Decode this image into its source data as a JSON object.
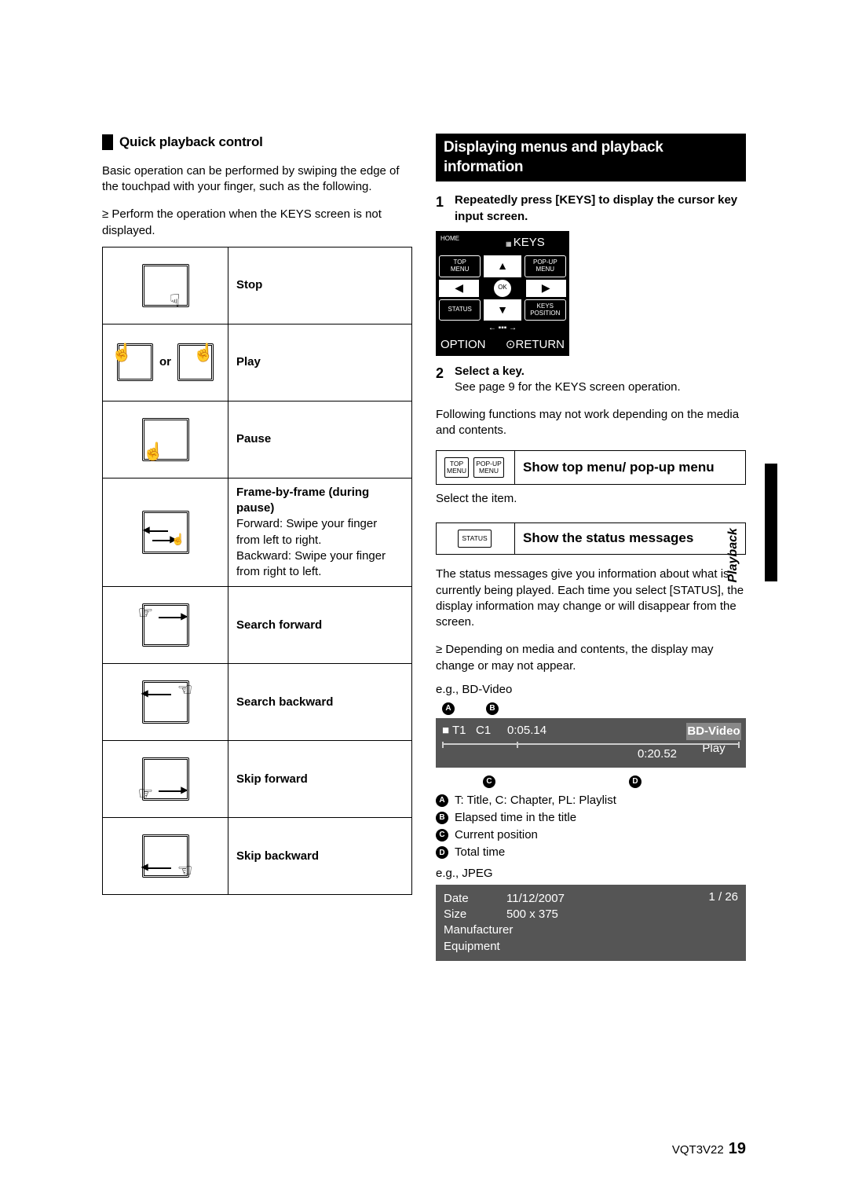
{
  "left": {
    "heading": "Quick playback control",
    "intro": "Basic operation can be performed by swiping the edge of the touchpad with your finger, such as the following.",
    "bullet": "Perform the operation when the KEYS screen is not displayed.",
    "or_label": "or",
    "gestures": [
      {
        "label": "Stop"
      },
      {
        "label": "Play"
      },
      {
        "label": "Pause"
      },
      {
        "bold": "Frame-by-frame (during pause)",
        "extra1": "Forward: Swipe your finger from left to right.",
        "extra2": "Backward: Swipe your finger from right to left."
      },
      {
        "label": "Search forward"
      },
      {
        "label": "Search backward"
      },
      {
        "label": "Skip forward"
      },
      {
        "label": "Skip backward"
      }
    ]
  },
  "right": {
    "heading": "Displaying menus and playback information",
    "step1": "Repeatedly press [KEYS] to display the cursor key input screen.",
    "step2": "Select a key.",
    "step2_sub": "See page 9 for the KEYS screen operation.",
    "note1": "Following functions may not work depending on the media and contents.",
    "feature1": "Show top menu/ pop-up menu",
    "select_item": "Select the item.",
    "feature2": "Show the status messages",
    "status_para": "The status messages give you information about what is currently being played. Each time you select [STATUS], the display information may change or will disappear from the screen.",
    "status_bullet": "Depending on media and contents, the display may change or may not appear.",
    "eg1": "e.g., BD-Video",
    "eg2": "e.g., JPEG",
    "remote": {
      "home": "HOME",
      "keys": "KEYS",
      "top_menu": "TOP\nMENU",
      "popup_menu": "POP-UP\nMENU",
      "ok": "OK",
      "status": "STATUS",
      "keys_pos": "KEYS\nPOSITION",
      "option": "OPTION",
      "return": "RETURN"
    },
    "mini_btn": {
      "top": "TOP\nMENU",
      "popup": "POP-UP\nMENU",
      "status": "STATUS"
    },
    "osd": {
      "title": "T1",
      "chapter": "C1",
      "elapsed": "0:05.14",
      "total": "0:20.52",
      "pill_top": "BD-Video",
      "pill_bot": "Play"
    },
    "letters": {
      "A": "T: Title, C: Chapter, PL: Playlist",
      "B": "Elapsed time in the title",
      "C": "Current position",
      "D": "Total time"
    },
    "jpeg": {
      "date_l": "Date",
      "date_v": "11/12/2007",
      "size_l": "Size",
      "size_v": "500 x 375",
      "mfr": "Manufacturer",
      "eq": "Equipment",
      "count": "1 / 26"
    }
  },
  "side_label": "Playback",
  "footer": {
    "code": "VQT3V22",
    "page": "19"
  }
}
